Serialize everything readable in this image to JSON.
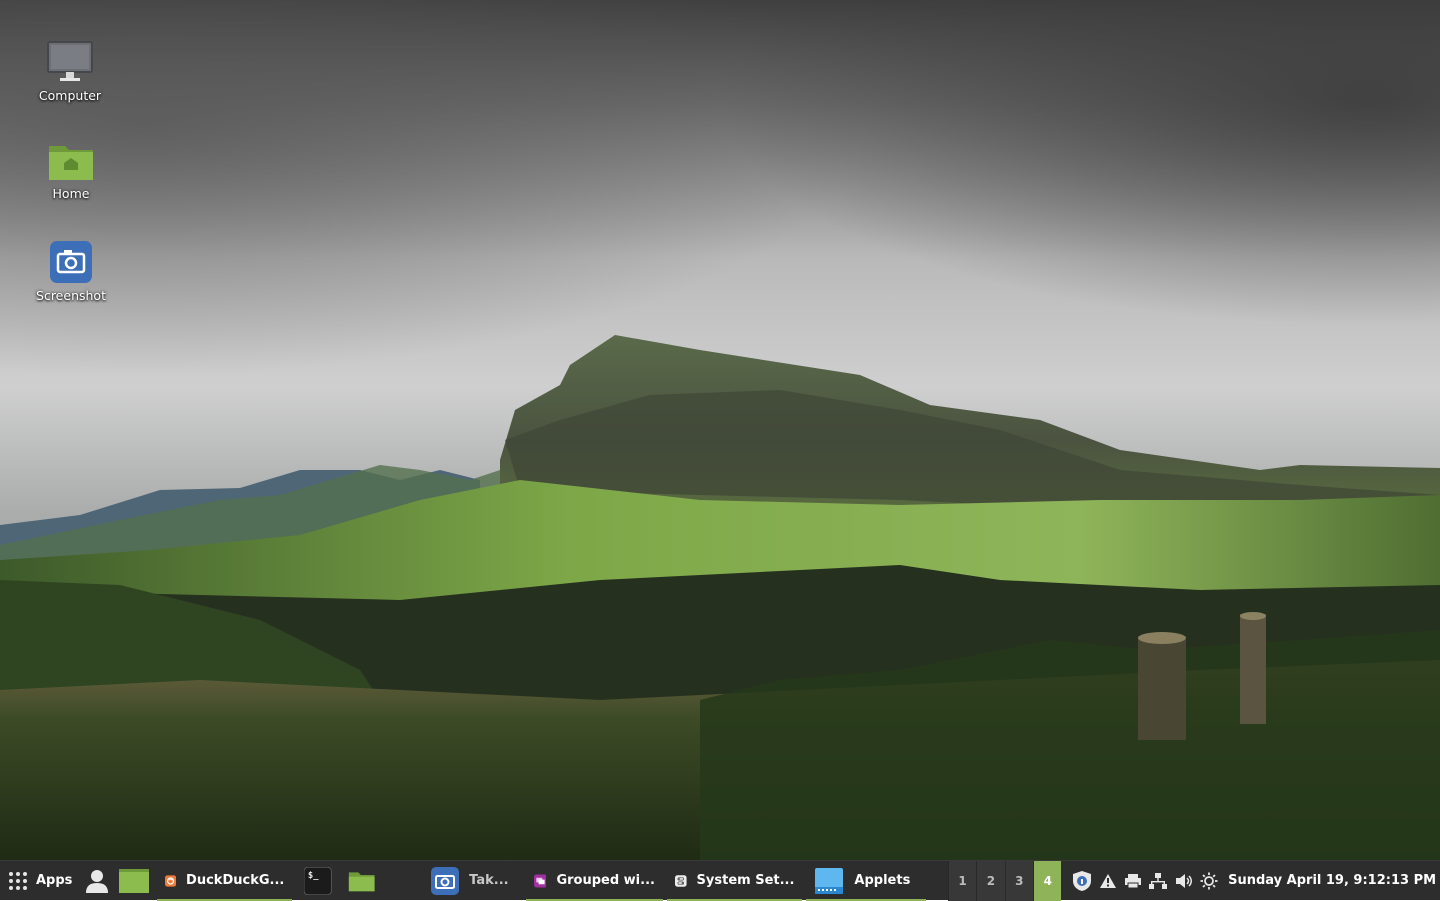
{
  "desktop": {
    "icons": [
      {
        "label": "Computer",
        "icon": "computer-icon"
      },
      {
        "label": "Home",
        "icon": "home-folder-icon"
      },
      {
        "label": "Screenshot",
        "icon": "screenshot-icon"
      }
    ]
  },
  "panel": {
    "menu_label": "Apps",
    "launchers": [
      "user-icon",
      "files-icon"
    ],
    "tasks": [
      {
        "label": "DuckDuckG...",
        "icon": "firefox-icon",
        "active": true
      },
      {
        "label": "",
        "icon": "terminal-icon",
        "active": false
      },
      {
        "label": "",
        "icon": "folder-icon",
        "active": false
      },
      {
        "label": "Tak...",
        "icon": "screenshot-icon",
        "active": false
      },
      {
        "label": "Grouped wi...",
        "icon": "grouped-windows-icon",
        "active": true
      },
      {
        "label": "System Set...",
        "icon": "settings-icon",
        "active": true
      },
      {
        "label": "Applets",
        "icon": "applets-icon",
        "active": true
      }
    ],
    "workspaces": [
      "1",
      "2",
      "3",
      "4"
    ],
    "current_workspace": "4",
    "tray_icons": [
      "update-shield-icon",
      "warning-icon",
      "printer-icon",
      "network-icon",
      "volume-icon",
      "brightness-icon"
    ],
    "clock": "Sunday April 19,  9:12:13 PM",
    "accent_color": "#8fb359"
  }
}
